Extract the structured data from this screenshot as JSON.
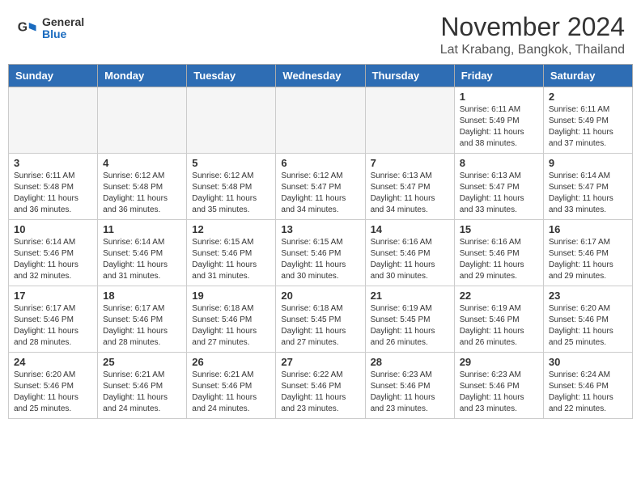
{
  "header": {
    "logo_general": "General",
    "logo_blue": "Blue",
    "month_title": "November 2024",
    "location": "Lat Krabang, Bangkok, Thailand"
  },
  "weekdays": [
    "Sunday",
    "Monday",
    "Tuesday",
    "Wednesday",
    "Thursday",
    "Friday",
    "Saturday"
  ],
  "weeks": [
    [
      {
        "day": "",
        "empty": true
      },
      {
        "day": "",
        "empty": true
      },
      {
        "day": "",
        "empty": true
      },
      {
        "day": "",
        "empty": true
      },
      {
        "day": "",
        "empty": true
      },
      {
        "day": "1",
        "sunrise": "6:11 AM",
        "sunset": "5:49 PM",
        "daylight": "11 hours and 38 minutes."
      },
      {
        "day": "2",
        "sunrise": "6:11 AM",
        "sunset": "5:49 PM",
        "daylight": "11 hours and 37 minutes."
      }
    ],
    [
      {
        "day": "3",
        "sunrise": "6:11 AM",
        "sunset": "5:48 PM",
        "daylight": "11 hours and 36 minutes."
      },
      {
        "day": "4",
        "sunrise": "6:12 AM",
        "sunset": "5:48 PM",
        "daylight": "11 hours and 36 minutes."
      },
      {
        "day": "5",
        "sunrise": "6:12 AM",
        "sunset": "5:48 PM",
        "daylight": "11 hours and 35 minutes."
      },
      {
        "day": "6",
        "sunrise": "6:12 AM",
        "sunset": "5:47 PM",
        "daylight": "11 hours and 34 minutes."
      },
      {
        "day": "7",
        "sunrise": "6:13 AM",
        "sunset": "5:47 PM",
        "daylight": "11 hours and 34 minutes."
      },
      {
        "day": "8",
        "sunrise": "6:13 AM",
        "sunset": "5:47 PM",
        "daylight": "11 hours and 33 minutes."
      },
      {
        "day": "9",
        "sunrise": "6:14 AM",
        "sunset": "5:47 PM",
        "daylight": "11 hours and 33 minutes."
      }
    ],
    [
      {
        "day": "10",
        "sunrise": "6:14 AM",
        "sunset": "5:46 PM",
        "daylight": "11 hours and 32 minutes."
      },
      {
        "day": "11",
        "sunrise": "6:14 AM",
        "sunset": "5:46 PM",
        "daylight": "11 hours and 31 minutes."
      },
      {
        "day": "12",
        "sunrise": "6:15 AM",
        "sunset": "5:46 PM",
        "daylight": "11 hours and 31 minutes."
      },
      {
        "day": "13",
        "sunrise": "6:15 AM",
        "sunset": "5:46 PM",
        "daylight": "11 hours and 30 minutes."
      },
      {
        "day": "14",
        "sunrise": "6:16 AM",
        "sunset": "5:46 PM",
        "daylight": "11 hours and 30 minutes."
      },
      {
        "day": "15",
        "sunrise": "6:16 AM",
        "sunset": "5:46 PM",
        "daylight": "11 hours and 29 minutes."
      },
      {
        "day": "16",
        "sunrise": "6:17 AM",
        "sunset": "5:46 PM",
        "daylight": "11 hours and 29 minutes."
      }
    ],
    [
      {
        "day": "17",
        "sunrise": "6:17 AM",
        "sunset": "5:46 PM",
        "daylight": "11 hours and 28 minutes."
      },
      {
        "day": "18",
        "sunrise": "6:17 AM",
        "sunset": "5:46 PM",
        "daylight": "11 hours and 28 minutes."
      },
      {
        "day": "19",
        "sunrise": "6:18 AM",
        "sunset": "5:46 PM",
        "daylight": "11 hours and 27 minutes."
      },
      {
        "day": "20",
        "sunrise": "6:18 AM",
        "sunset": "5:45 PM",
        "daylight": "11 hours and 27 minutes."
      },
      {
        "day": "21",
        "sunrise": "6:19 AM",
        "sunset": "5:45 PM",
        "daylight": "11 hours and 26 minutes."
      },
      {
        "day": "22",
        "sunrise": "6:19 AM",
        "sunset": "5:46 PM",
        "daylight": "11 hours and 26 minutes."
      },
      {
        "day": "23",
        "sunrise": "6:20 AM",
        "sunset": "5:46 PM",
        "daylight": "11 hours and 25 minutes."
      }
    ],
    [
      {
        "day": "24",
        "sunrise": "6:20 AM",
        "sunset": "5:46 PM",
        "daylight": "11 hours and 25 minutes."
      },
      {
        "day": "25",
        "sunrise": "6:21 AM",
        "sunset": "5:46 PM",
        "daylight": "11 hours and 24 minutes."
      },
      {
        "day": "26",
        "sunrise": "6:21 AM",
        "sunset": "5:46 PM",
        "daylight": "11 hours and 24 minutes."
      },
      {
        "day": "27",
        "sunrise": "6:22 AM",
        "sunset": "5:46 PM",
        "daylight": "11 hours and 23 minutes."
      },
      {
        "day": "28",
        "sunrise": "6:23 AM",
        "sunset": "5:46 PM",
        "daylight": "11 hours and 23 minutes."
      },
      {
        "day": "29",
        "sunrise": "6:23 AM",
        "sunset": "5:46 PM",
        "daylight": "11 hours and 23 minutes."
      },
      {
        "day": "30",
        "sunrise": "6:24 AM",
        "sunset": "5:46 PM",
        "daylight": "11 hours and 22 minutes."
      }
    ]
  ]
}
